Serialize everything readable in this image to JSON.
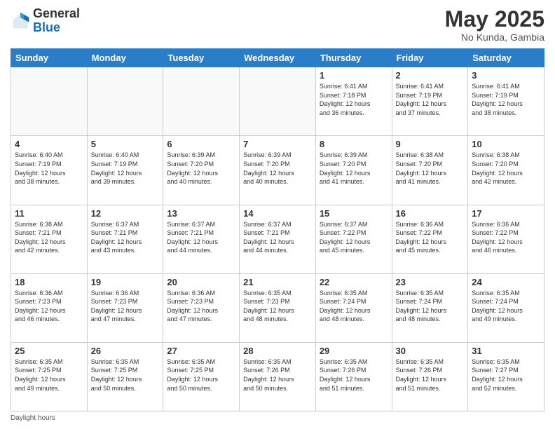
{
  "logo": {
    "general": "General",
    "blue": "Blue"
  },
  "title": "May 2025",
  "subtitle": "No Kunda, Gambia",
  "days_of_week": [
    "Sunday",
    "Monday",
    "Tuesday",
    "Wednesday",
    "Thursday",
    "Friday",
    "Saturday"
  ],
  "footer_text": "Daylight hours",
  "weeks": [
    [
      {
        "day": "",
        "info": ""
      },
      {
        "day": "",
        "info": ""
      },
      {
        "day": "",
        "info": ""
      },
      {
        "day": "",
        "info": ""
      },
      {
        "day": "1",
        "info": "Sunrise: 6:41 AM\nSunset: 7:18 PM\nDaylight: 12 hours\nand 36 minutes."
      },
      {
        "day": "2",
        "info": "Sunrise: 6:41 AM\nSunset: 7:19 PM\nDaylight: 12 hours\nand 37 minutes."
      },
      {
        "day": "3",
        "info": "Sunrise: 6:41 AM\nSunset: 7:19 PM\nDaylight: 12 hours\nand 38 minutes."
      }
    ],
    [
      {
        "day": "4",
        "info": "Sunrise: 6:40 AM\nSunset: 7:19 PM\nDaylight: 12 hours\nand 38 minutes."
      },
      {
        "day": "5",
        "info": "Sunrise: 6:40 AM\nSunset: 7:19 PM\nDaylight: 12 hours\nand 39 minutes."
      },
      {
        "day": "6",
        "info": "Sunrise: 6:39 AM\nSunset: 7:20 PM\nDaylight: 12 hours\nand 40 minutes."
      },
      {
        "day": "7",
        "info": "Sunrise: 6:39 AM\nSunset: 7:20 PM\nDaylight: 12 hours\nand 40 minutes."
      },
      {
        "day": "8",
        "info": "Sunrise: 6:39 AM\nSunset: 7:20 PM\nDaylight: 12 hours\nand 41 minutes."
      },
      {
        "day": "9",
        "info": "Sunrise: 6:38 AM\nSunset: 7:20 PM\nDaylight: 12 hours\nand 41 minutes."
      },
      {
        "day": "10",
        "info": "Sunrise: 6:38 AM\nSunset: 7:20 PM\nDaylight: 12 hours\nand 42 minutes."
      }
    ],
    [
      {
        "day": "11",
        "info": "Sunrise: 6:38 AM\nSunset: 7:21 PM\nDaylight: 12 hours\nand 42 minutes."
      },
      {
        "day": "12",
        "info": "Sunrise: 6:37 AM\nSunset: 7:21 PM\nDaylight: 12 hours\nand 43 minutes."
      },
      {
        "day": "13",
        "info": "Sunrise: 6:37 AM\nSunset: 7:21 PM\nDaylight: 12 hours\nand 44 minutes."
      },
      {
        "day": "14",
        "info": "Sunrise: 6:37 AM\nSunset: 7:21 PM\nDaylight: 12 hours\nand 44 minutes."
      },
      {
        "day": "15",
        "info": "Sunrise: 6:37 AM\nSunset: 7:22 PM\nDaylight: 12 hours\nand 45 minutes."
      },
      {
        "day": "16",
        "info": "Sunrise: 6:36 AM\nSunset: 7:22 PM\nDaylight: 12 hours\nand 45 minutes."
      },
      {
        "day": "17",
        "info": "Sunrise: 6:36 AM\nSunset: 7:22 PM\nDaylight: 12 hours\nand 46 minutes."
      }
    ],
    [
      {
        "day": "18",
        "info": "Sunrise: 6:36 AM\nSunset: 7:23 PM\nDaylight: 12 hours\nand 46 minutes."
      },
      {
        "day": "19",
        "info": "Sunrise: 6:36 AM\nSunset: 7:23 PM\nDaylight: 12 hours\nand 47 minutes."
      },
      {
        "day": "20",
        "info": "Sunrise: 6:36 AM\nSunset: 7:23 PM\nDaylight: 12 hours\nand 47 minutes."
      },
      {
        "day": "21",
        "info": "Sunrise: 6:35 AM\nSunset: 7:23 PM\nDaylight: 12 hours\nand 48 minutes."
      },
      {
        "day": "22",
        "info": "Sunrise: 6:35 AM\nSunset: 7:24 PM\nDaylight: 12 hours\nand 48 minutes."
      },
      {
        "day": "23",
        "info": "Sunrise: 6:35 AM\nSunset: 7:24 PM\nDaylight: 12 hours\nand 48 minutes."
      },
      {
        "day": "24",
        "info": "Sunrise: 6:35 AM\nSunset: 7:24 PM\nDaylight: 12 hours\nand 49 minutes."
      }
    ],
    [
      {
        "day": "25",
        "info": "Sunrise: 6:35 AM\nSunset: 7:25 PM\nDaylight: 12 hours\nand 49 minutes."
      },
      {
        "day": "26",
        "info": "Sunrise: 6:35 AM\nSunset: 7:25 PM\nDaylight: 12 hours\nand 50 minutes."
      },
      {
        "day": "27",
        "info": "Sunrise: 6:35 AM\nSunset: 7:25 PM\nDaylight: 12 hours\nand 50 minutes."
      },
      {
        "day": "28",
        "info": "Sunrise: 6:35 AM\nSunset: 7:26 PM\nDaylight: 12 hours\nand 50 minutes."
      },
      {
        "day": "29",
        "info": "Sunrise: 6:35 AM\nSunset: 7:26 PM\nDaylight: 12 hours\nand 51 minutes."
      },
      {
        "day": "30",
        "info": "Sunrise: 6:35 AM\nSunset: 7:26 PM\nDaylight: 12 hours\nand 51 minutes."
      },
      {
        "day": "31",
        "info": "Sunrise: 6:35 AM\nSunset: 7:27 PM\nDaylight: 12 hours\nand 52 minutes."
      }
    ]
  ]
}
